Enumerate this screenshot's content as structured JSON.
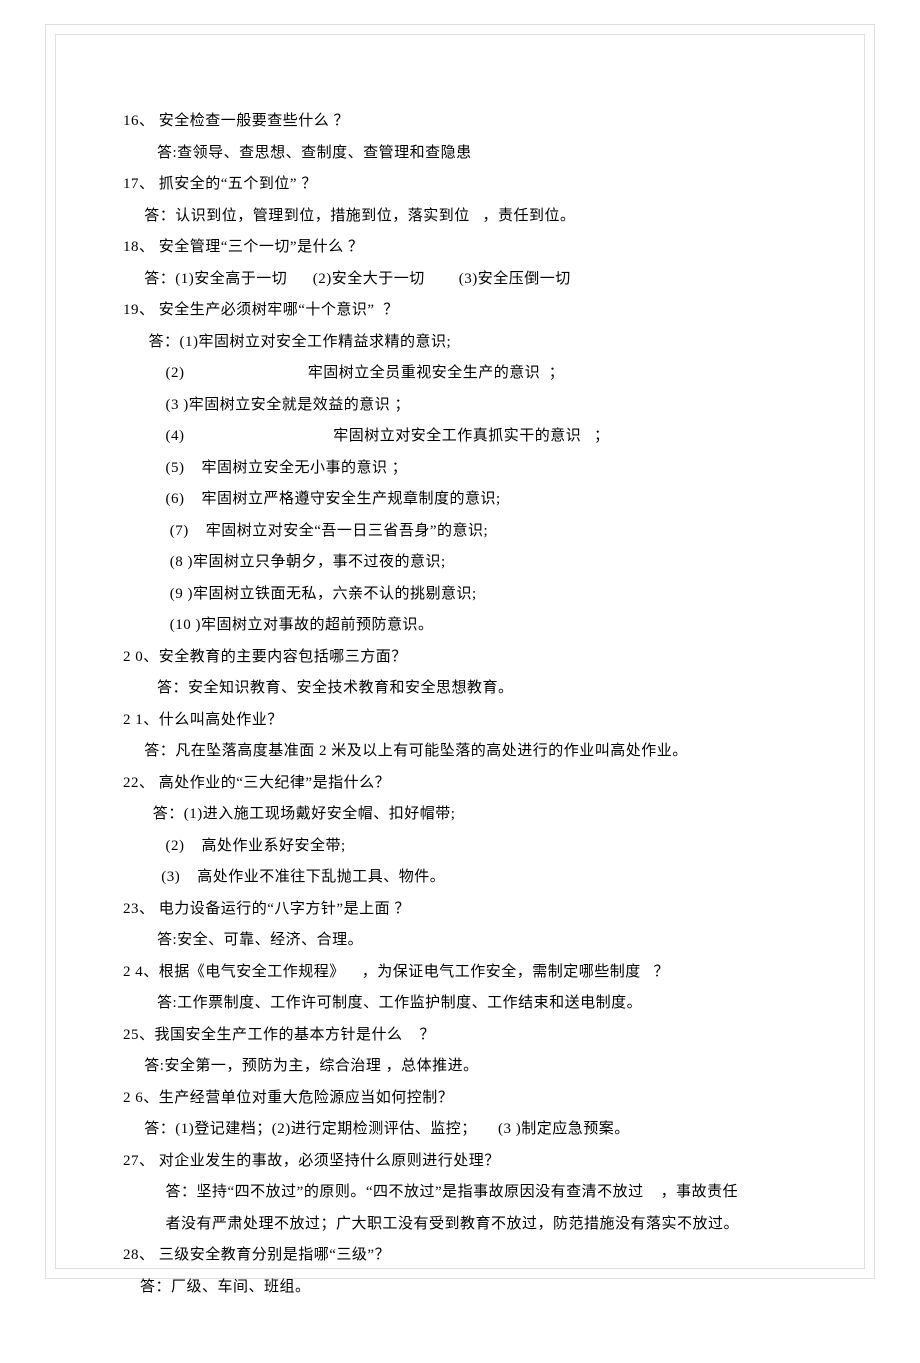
{
  "lines": [
    "16、 安全检查一般要查些什么 ？",
    "        答:查领导、查思想、查制度、查管理和查隐患",
    "17、 抓安全的“五个到位” ？",
    "     答：认识到位，管理到位，措施到位，落实到位   ，责任到位。",
    "18、 安全管理“三个一切”是什么 ？",
    "     答：(1)安全高于一切      (2)安全大于一切        (3)安全压倒一切",
    "19、 安全生产必须树牢哪“十个意识”  ？",
    "      答：(1)牢固树立对安全工作精益求精的意识;",
    "          (2)                             牢固树立全员重视安全生产的意识  ；",
    "          (3 )牢固树立安全就是效益的意识 ；",
    "          (4)                                   牢固树立对安全工作真抓实干的意识   ；",
    "          (5)    牢固树立安全无小事的意识 ；",
    "          (6)    牢固树立严格遵守安全生产规章制度的意识;",
    "           (7)    牢固树立对安全“吾一日三省吾身”的意识;",
    "           (8 )牢固树立只争朝夕，事不过夜的意识;",
    "           (9 )牢固树立铁面无私，六亲不认的挑剔意识;",
    "           (10 )牢固树立对事故的超前预防意识。",
    "2 0、安全教育的主要内容包括哪三方面？",
    "        答：安全知识教育、安全技术教育和安全思想教育。",
    "2 1、什么叫高处作业？",
    "     答：凡在坠落高度基准面 2 米及以上有可能坠落的高处进行的作业叫高处作业。",
    "22、 高处作业的“三大纪律”是指什么？",
    "       答：(1)进入施工现场戴好安全帽、扣好帽带;",
    "          (2)    高处作业系好安全带;",
    "         (3)    高处作业不准往下乱抛工具、物件。",
    "23、 电力设备运行的“八字方针”是上面 ？",
    "        答:安全、可靠、经济、合理。",
    "2 4、根据《电气安全工作规程》    ，为保证电气工作安全，需制定哪些制度   ？",
    "        答:工作票制度、工作许可制度、工作监护制度、工作结束和送电制度。",
    "25、我国安全生产工作的基本方针是什么    ？",
    "     答:安全第一，预防为主，综合治理 ，总体推进。",
    "2 6、生产经营单位对重大危险源应当如何控制？",
    "     答：(1)登记建档；(2)进行定期检测评估、监控；     (3 )制定应急预案。",
    "27、 对企业发生的事故，必须坚持什么原则进行处理？",
    "          答：坚持“四不放过”的原则。“四不放过”是指事故原因没有查清不放过    ，事故责任",
    "          者没有严肃处理不放过；广大职工没有受到教育不放过，防范措施没有落实不放过。",
    "28、 三级安全教育分别是指哪“三级”？",
    "    答：厂级、车间、班组。"
  ]
}
